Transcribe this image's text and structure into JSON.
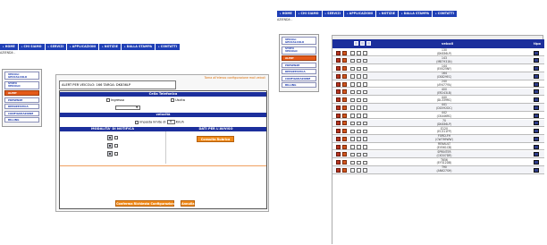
{
  "nav": [
    "HOME",
    "CHI SIAMO",
    "SERVIZI",
    "APPLICAZIONI",
    "NOTIZIE",
    "DALLA STAMPA",
    "CONTATTI"
  ],
  "azienda": "AZIENDA -",
  "sidebar": [
    {
      "label": "VEICOLI",
      "two": "GEOCALCOLO",
      "active": false
    },
    {
      "label": "STATO",
      "two": "VEICOLO",
      "active": false
    },
    {
      "label": "ALERT",
      "active": true
    },
    {
      "label": "PRESENZE",
      "active": false
    },
    {
      "label": "REPORTISTICA",
      "active": false
    },
    {
      "label": "CONFIGURAZIONE",
      "active": false
    },
    {
      "label": "BILLING",
      "active": false
    }
  ],
  "left_panel": {
    "header": "ALERT PER VEICOLO: 166  TARGA: DK836LP",
    "note": "Torna all'elenco configurazione mail veicoli",
    "cella_title": "Cella Telefonica",
    "ingresso": "Ingresso",
    "uscita": "Uscita",
    "velocita_title": "velocità",
    "imposta_limite": "imposta limite di",
    "speed_value": "0",
    "speed_unit": "Km/h",
    "modalita_title": "MODALITA' DI NOTIFICA",
    "dati_title": "DATI PER L'AVVISO",
    "consulta_rubrica": "Consulta Rubrica",
    "conferma": "Conferma Richiesta Configurazione",
    "annulla": "Annulla"
  },
  "right_panel": {
    "col_veicoli": "veicoli",
    "col_tipo": "tipo",
    "rows": [
      [
        "130",
        "(DK836LP)"
      ],
      [
        "143",
        "(MB7931N)"
      ],
      [
        "144",
        "(EV025NF)"
      ],
      [
        "164",
        "(CK829EC)"
      ],
      [
        "240",
        "(AY477YA)"
      ],
      [
        "400",
        "(ER243LB)"
      ],
      [
        "440",
        "(DL339RC)"
      ],
      [
        "441",
        "(DG592DC)"
      ],
      [
        "442",
        "(CK446RC)"
      ],
      [
        "70",
        "(DK836LP)"
      ],
      [
        "E120",
        "(EC311FP)"
      ],
      [
        "FORD-FH",
        "(CW769WW)"
      ],
      [
        "RENAULT",
        "(EV561CB)"
      ],
      [
        "SPRINTER",
        "(CK507DR)"
      ],
      [
        "T656",
        "(EY312DB)"
      ],
      [
        "T90",
        "(AN627SH)"
      ]
    ]
  },
  "colors": {
    "nav_blue": "#1f3fb5",
    "header_blue": "#1c2f9c",
    "alert_orange": "#e45a1a",
    "button_orange": "#f08a1a"
  },
  "icons": [
    "vehicle-type-icon",
    "edit-icon",
    "mail-icon",
    "sms-icon",
    "fax-icon"
  ]
}
